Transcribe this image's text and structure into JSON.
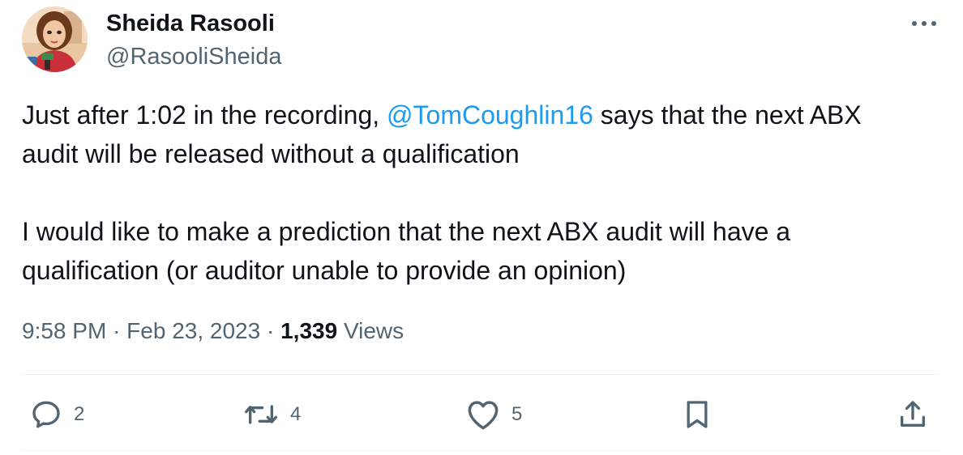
{
  "author": {
    "name": "Sheida Rasooli",
    "handle": "@RasooliSheida"
  },
  "tweet": {
    "line1_pre": "Just after 1:02 in the recording,",
    "mention": "@TomCoughlin16",
    "line1_post": "says that the next ABX",
    "line2": "audit will be released without a qualification",
    "line3": "I would like to make a prediction that the next ABX audit will have a",
    "line4": "qualification (or auditor unable to provide an opinion)"
  },
  "meta": {
    "time": "9:58 PM",
    "separator": "·",
    "date": "Feb 23, 2023",
    "views_count": "1,339",
    "views_label": "Views"
  },
  "actions": {
    "replies": "2",
    "retweets": "4",
    "likes": "5"
  },
  "icons": {
    "more": "more-icon",
    "reply": "reply-icon",
    "retweet": "retweet-icon",
    "like": "heart-icon",
    "bookmark": "bookmark-icon",
    "share": "share-icon"
  },
  "colors": {
    "accent": "#1d9bf0",
    "text": "#0f1419",
    "secondary": "#536471"
  }
}
